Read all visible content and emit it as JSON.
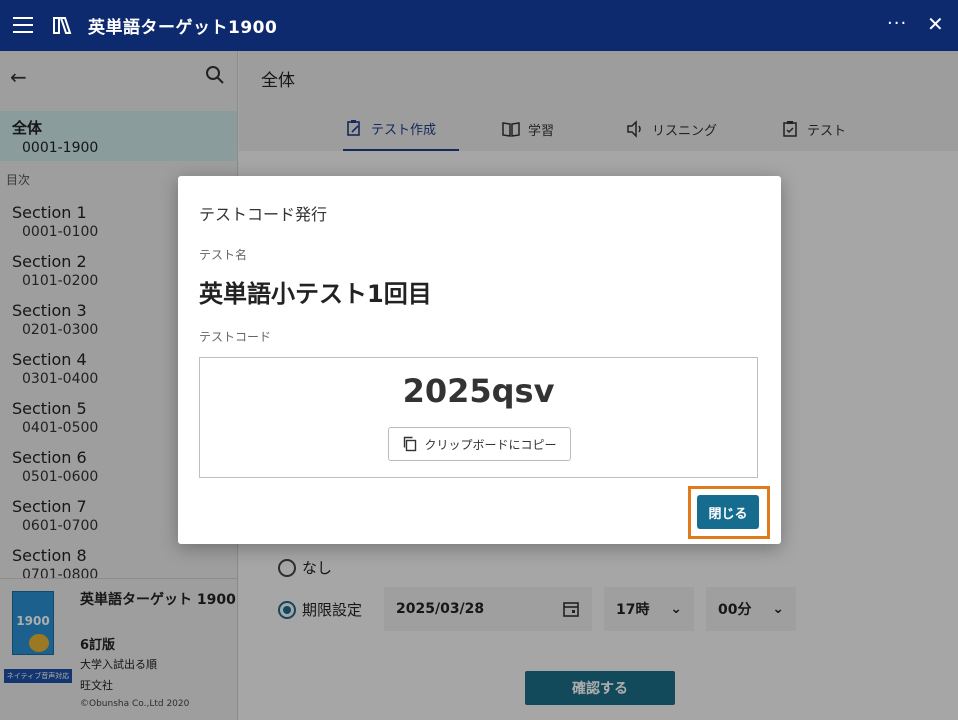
{
  "titlebar": {
    "app_title": "英単語ターゲット1900",
    "menu_icon": "hamburger-icon",
    "logo_icon": "book-icon",
    "more": "···",
    "close": "✕"
  },
  "sidebar": {
    "back_icon": "←",
    "all": {
      "label": "全体",
      "range": "0001-1900"
    },
    "toc_label": "目次",
    "sections": [
      {
        "label": "Section 1",
        "range": "0001-0100"
      },
      {
        "label": "Section 2",
        "range": "0101-0200"
      },
      {
        "label": "Section 3",
        "range": "0201-0300"
      },
      {
        "label": "Section 4",
        "range": "0301-0400"
      },
      {
        "label": "Section 5",
        "range": "0401-0500"
      },
      {
        "label": "Section 6",
        "range": "0501-0600"
      },
      {
        "label": "Section 7",
        "range": "0601-0700"
      },
      {
        "label": "Section 8",
        "range": "0701-0800"
      }
    ],
    "book": {
      "cover_number": "1900",
      "native_badge": "ネイティブ音声対応",
      "title": "英単語ターゲット 1900",
      "edition": "6訂版",
      "subtitle": "大学入試出る順",
      "publisher": "旺文社",
      "copyright": "©Obunsha Co.,Ltd 2020"
    }
  },
  "main": {
    "title": "全体",
    "tabs": [
      {
        "label": "テスト作成",
        "icon": "clipboard-edit-icon",
        "active": true
      },
      {
        "label": "学習",
        "icon": "open-book-icon",
        "active": false
      },
      {
        "label": "リスニング",
        "icon": "speaker-icon",
        "active": false
      },
      {
        "label": "テスト",
        "icon": "clipboard-check-icon",
        "active": false
      }
    ],
    "deadline": {
      "none_label": "なし",
      "set_label": "期限設定",
      "date": "2025/03/28",
      "hour": "17時",
      "minute": "00分"
    },
    "confirm_label": "確認する"
  },
  "dialog": {
    "title": "テストコード発行",
    "name_label": "テスト名",
    "name": "英単語小テスト1回目",
    "code_label": "テストコード",
    "code": "2025qsv",
    "copy_label": "クリップボードにコピー",
    "close_label": "閉じる",
    "highlight_color": "#e07a1a"
  }
}
